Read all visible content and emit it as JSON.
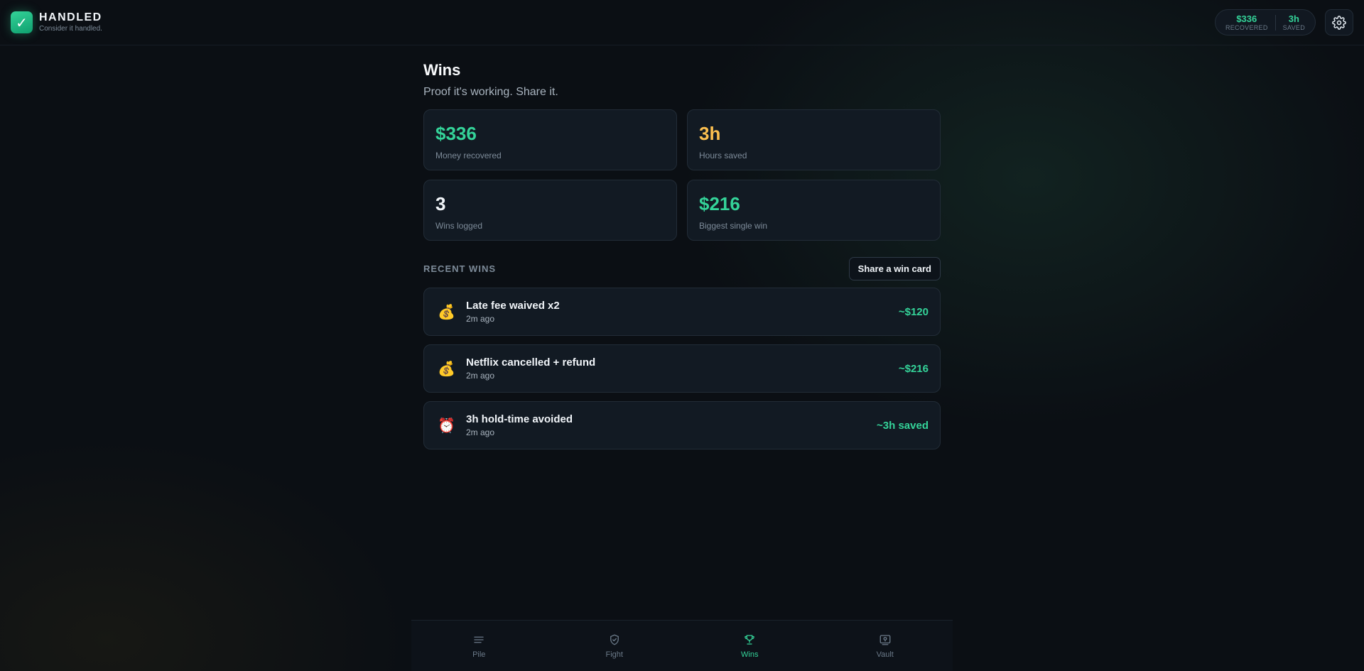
{
  "header": {
    "brand_name": "HANDLED",
    "tagline": "Consider it handled.",
    "logo_glyph": "✓",
    "recovered_value": "$336",
    "recovered_label": "RECOVERED",
    "saved_value": "3h",
    "saved_label": "SAVED",
    "settings_icon": "gear-icon"
  },
  "page": {
    "title": "Wins",
    "subtitle": "Proof it's working. Share it."
  },
  "stats": [
    {
      "value": "$336",
      "label": "Money recovered",
      "color": "#34d399"
    },
    {
      "value": "3h",
      "label": "Hours saved",
      "color": "#fbbf4f"
    },
    {
      "value": "3",
      "label": "Wins logged",
      "color": "#f1f5f9"
    },
    {
      "value": "$216",
      "label": "Biggest single win",
      "color": "#34d399"
    }
  ],
  "recent": {
    "section_label": "RECENT WINS",
    "share_label": "Share a win card",
    "items": [
      {
        "icon": "💰",
        "icon_name": "money-bag-icon",
        "title": "Late fee waived x2",
        "time": "2m ago",
        "amount": "~$120"
      },
      {
        "icon": "💰",
        "icon_name": "money-bag-icon",
        "title": "Netflix cancelled + refund",
        "time": "2m ago",
        "amount": "~$216"
      },
      {
        "icon": "⏰",
        "icon_name": "alarm-clock-icon",
        "title": "3h hold-time avoided",
        "time": "2m ago",
        "amount": "~3h saved"
      }
    ]
  },
  "nav": {
    "items": [
      {
        "label": "Pile",
        "icon": "list-icon",
        "active": false
      },
      {
        "label": "Fight",
        "icon": "shield-icon",
        "active": false
      },
      {
        "label": "Wins",
        "icon": "trophy-icon",
        "active": true
      },
      {
        "label": "Vault",
        "icon": "vault-icon",
        "active": false
      }
    ]
  },
  "colors": {
    "accent": "#34d399",
    "amber": "#fbbf4f",
    "background": "#0b0f14",
    "card": "#121a23"
  }
}
